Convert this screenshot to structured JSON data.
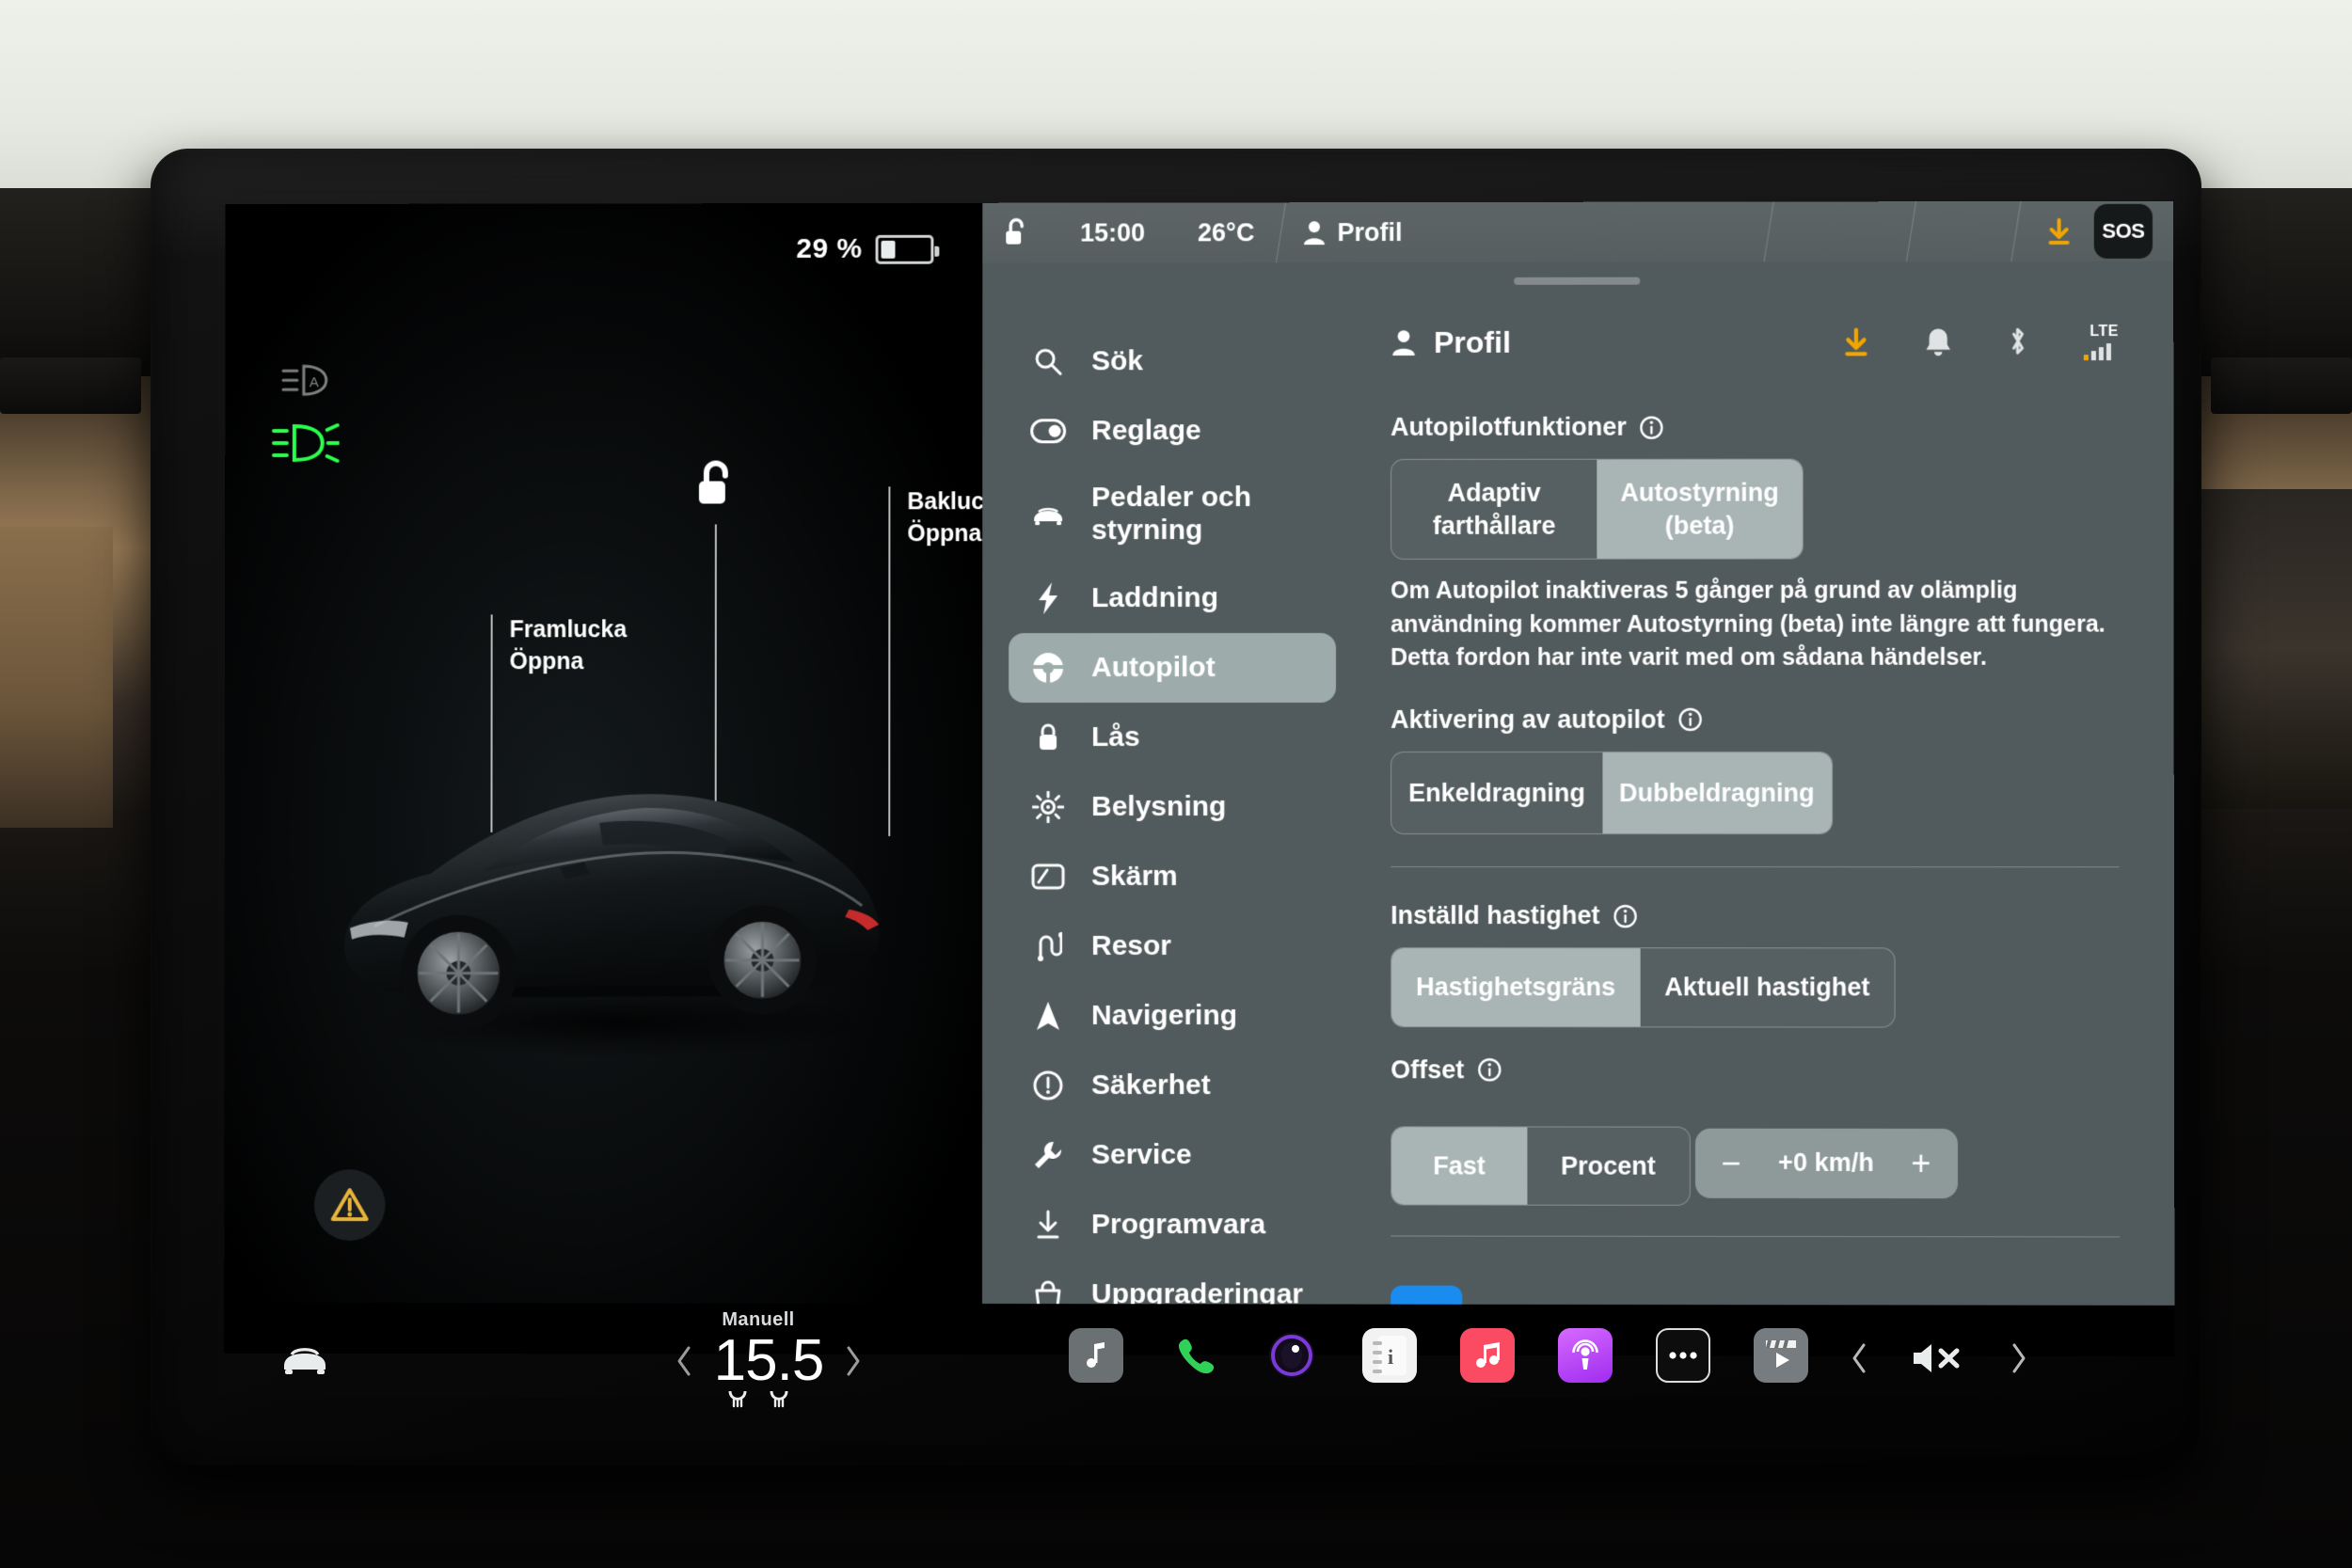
{
  "vehicle_view": {
    "battery_percent_label": "29 %",
    "battery_level": 29,
    "indicators": [
      {
        "name": "auto-high-beam-icon",
        "state": "off"
      },
      {
        "name": "low-beam-icon",
        "state": "on",
        "color": "#2bff4e"
      }
    ],
    "hotspots": [
      {
        "name": "frunk",
        "title": "Framlucka",
        "action": "Öppna"
      },
      {
        "name": "trunk",
        "title": "Baklucka",
        "action": "Öppna"
      }
    ],
    "lock_state": "unlocked",
    "charge_port_icon": "bolt-icon",
    "warning_icon": "warning-triangle-icon"
  },
  "statusbar": {
    "lock_icon": "unlock-icon",
    "time": "15:00",
    "temperature": "26°C",
    "profile_icon": "person-icon",
    "profile": "Profil",
    "download_icon": "software-update-icon",
    "sos": "SOS"
  },
  "sidebar": {
    "search": {
      "icon": "search-icon",
      "label": "Sök"
    },
    "items": [
      {
        "icon": "toggle-icon",
        "label": "Reglage",
        "active": false
      },
      {
        "icon": "car-icon",
        "label": "Pedaler och styrning",
        "active": false
      },
      {
        "icon": "bolt-icon",
        "label": "Laddning",
        "active": false
      },
      {
        "icon": "steering-wheel-icon",
        "label": "Autopilot",
        "active": true
      },
      {
        "icon": "lock-icon",
        "label": "Lås",
        "active": false
      },
      {
        "icon": "sun-icon",
        "label": "Belysning",
        "active": false
      },
      {
        "icon": "display-icon",
        "label": "Skärm",
        "active": false
      },
      {
        "icon": "route-icon",
        "label": "Resor",
        "active": false
      },
      {
        "icon": "navigation-arrow-icon",
        "label": "Navigering",
        "active": false
      },
      {
        "icon": "alert-circle-icon",
        "label": "Säkerhet",
        "active": false
      },
      {
        "icon": "wrench-icon",
        "label": "Service",
        "active": false
      },
      {
        "icon": "download-icon",
        "label": "Programvara",
        "active": false
      },
      {
        "icon": "bag-icon",
        "label": "Uppgraderingar",
        "active": false
      }
    ]
  },
  "panel": {
    "header": {
      "icon": "person-icon",
      "title": "Profil",
      "icons": [
        "software-update-icon",
        "bell-icon",
        "bluetooth-icon",
        "cellular-icon"
      ],
      "network_label": "LTE"
    },
    "sections": [
      {
        "name": "autopilot-features",
        "title": "Autopilotfunktioner",
        "info_icon": "info-icon",
        "options": [
          {
            "label": "Adaptiv\nfarthållare",
            "selected": false
          },
          {
            "label": "Autostyrning\n(beta)",
            "selected": true
          }
        ],
        "note": "Om Autopilot inaktiveras 5 gånger på grund av olämplig användning kommer Autostyrning (beta) inte längre att fungera. Detta fordon har inte varit med om sådana händelser."
      },
      {
        "name": "autopilot-engage",
        "title": "Aktivering av autopilot",
        "info_icon": "info-icon",
        "options": [
          {
            "label": "Enkeldragning",
            "selected": false
          },
          {
            "label": "Dubbeldragning",
            "selected": true
          }
        ]
      },
      {
        "name": "set-speed",
        "title": "Inställd hastighet",
        "info_icon": "info-icon",
        "options": [
          {
            "label": "Hastighetsgräns",
            "selected": true
          },
          {
            "label": "Aktuell hastighet",
            "selected": false
          }
        ]
      },
      {
        "name": "offset",
        "title": "Offset",
        "info_icon": "info-icon",
        "options": [
          {
            "label": "Fast",
            "selected": true
          },
          {
            "label": "Procent",
            "selected": false
          }
        ]
      }
    ],
    "offset_stepper": {
      "minus": "−",
      "value": "+0 km/h",
      "plus": "+"
    }
  },
  "dock": {
    "car_icon": "car-front-icon",
    "climate": {
      "mode": "Manuell",
      "temperature": "15.5",
      "prev_icon": "chevron-left-icon",
      "next_icon": "chevron-right-icon",
      "seat_heaters": [
        "seat-heater-left-icon",
        "seat-heater-right-icon"
      ]
    },
    "apps": [
      {
        "name": "media-app-icon",
        "color": "#6b7073"
      },
      {
        "name": "phone-app-icon",
        "color": "#31d158"
      },
      {
        "name": "camera-app-icon",
        "color": "#2a1a3a"
      },
      {
        "name": "notes-app-icon",
        "color": "#f2f2f2"
      },
      {
        "name": "music-app-icon",
        "color": "#fa4b63"
      },
      {
        "name": "podcasts-app-icon",
        "color": "#c24bf5"
      },
      {
        "name": "more-app-icon",
        "color": "#111111"
      },
      {
        "name": "video-app-icon",
        "color": "#777c80"
      }
    ],
    "volume": {
      "prev_icon": "chevron-left-icon",
      "mute_icon": "volume-mute-icon",
      "next_icon": "chevron-right-icon"
    }
  },
  "colors": {
    "panel_bg": "#515a5c",
    "topbar_bg": "#5d6567",
    "selected_seg": "#a8b5b4",
    "accent_amber": "#f0a500",
    "indicator_green": "#2bff4e",
    "blue": "#1a8cf0"
  }
}
